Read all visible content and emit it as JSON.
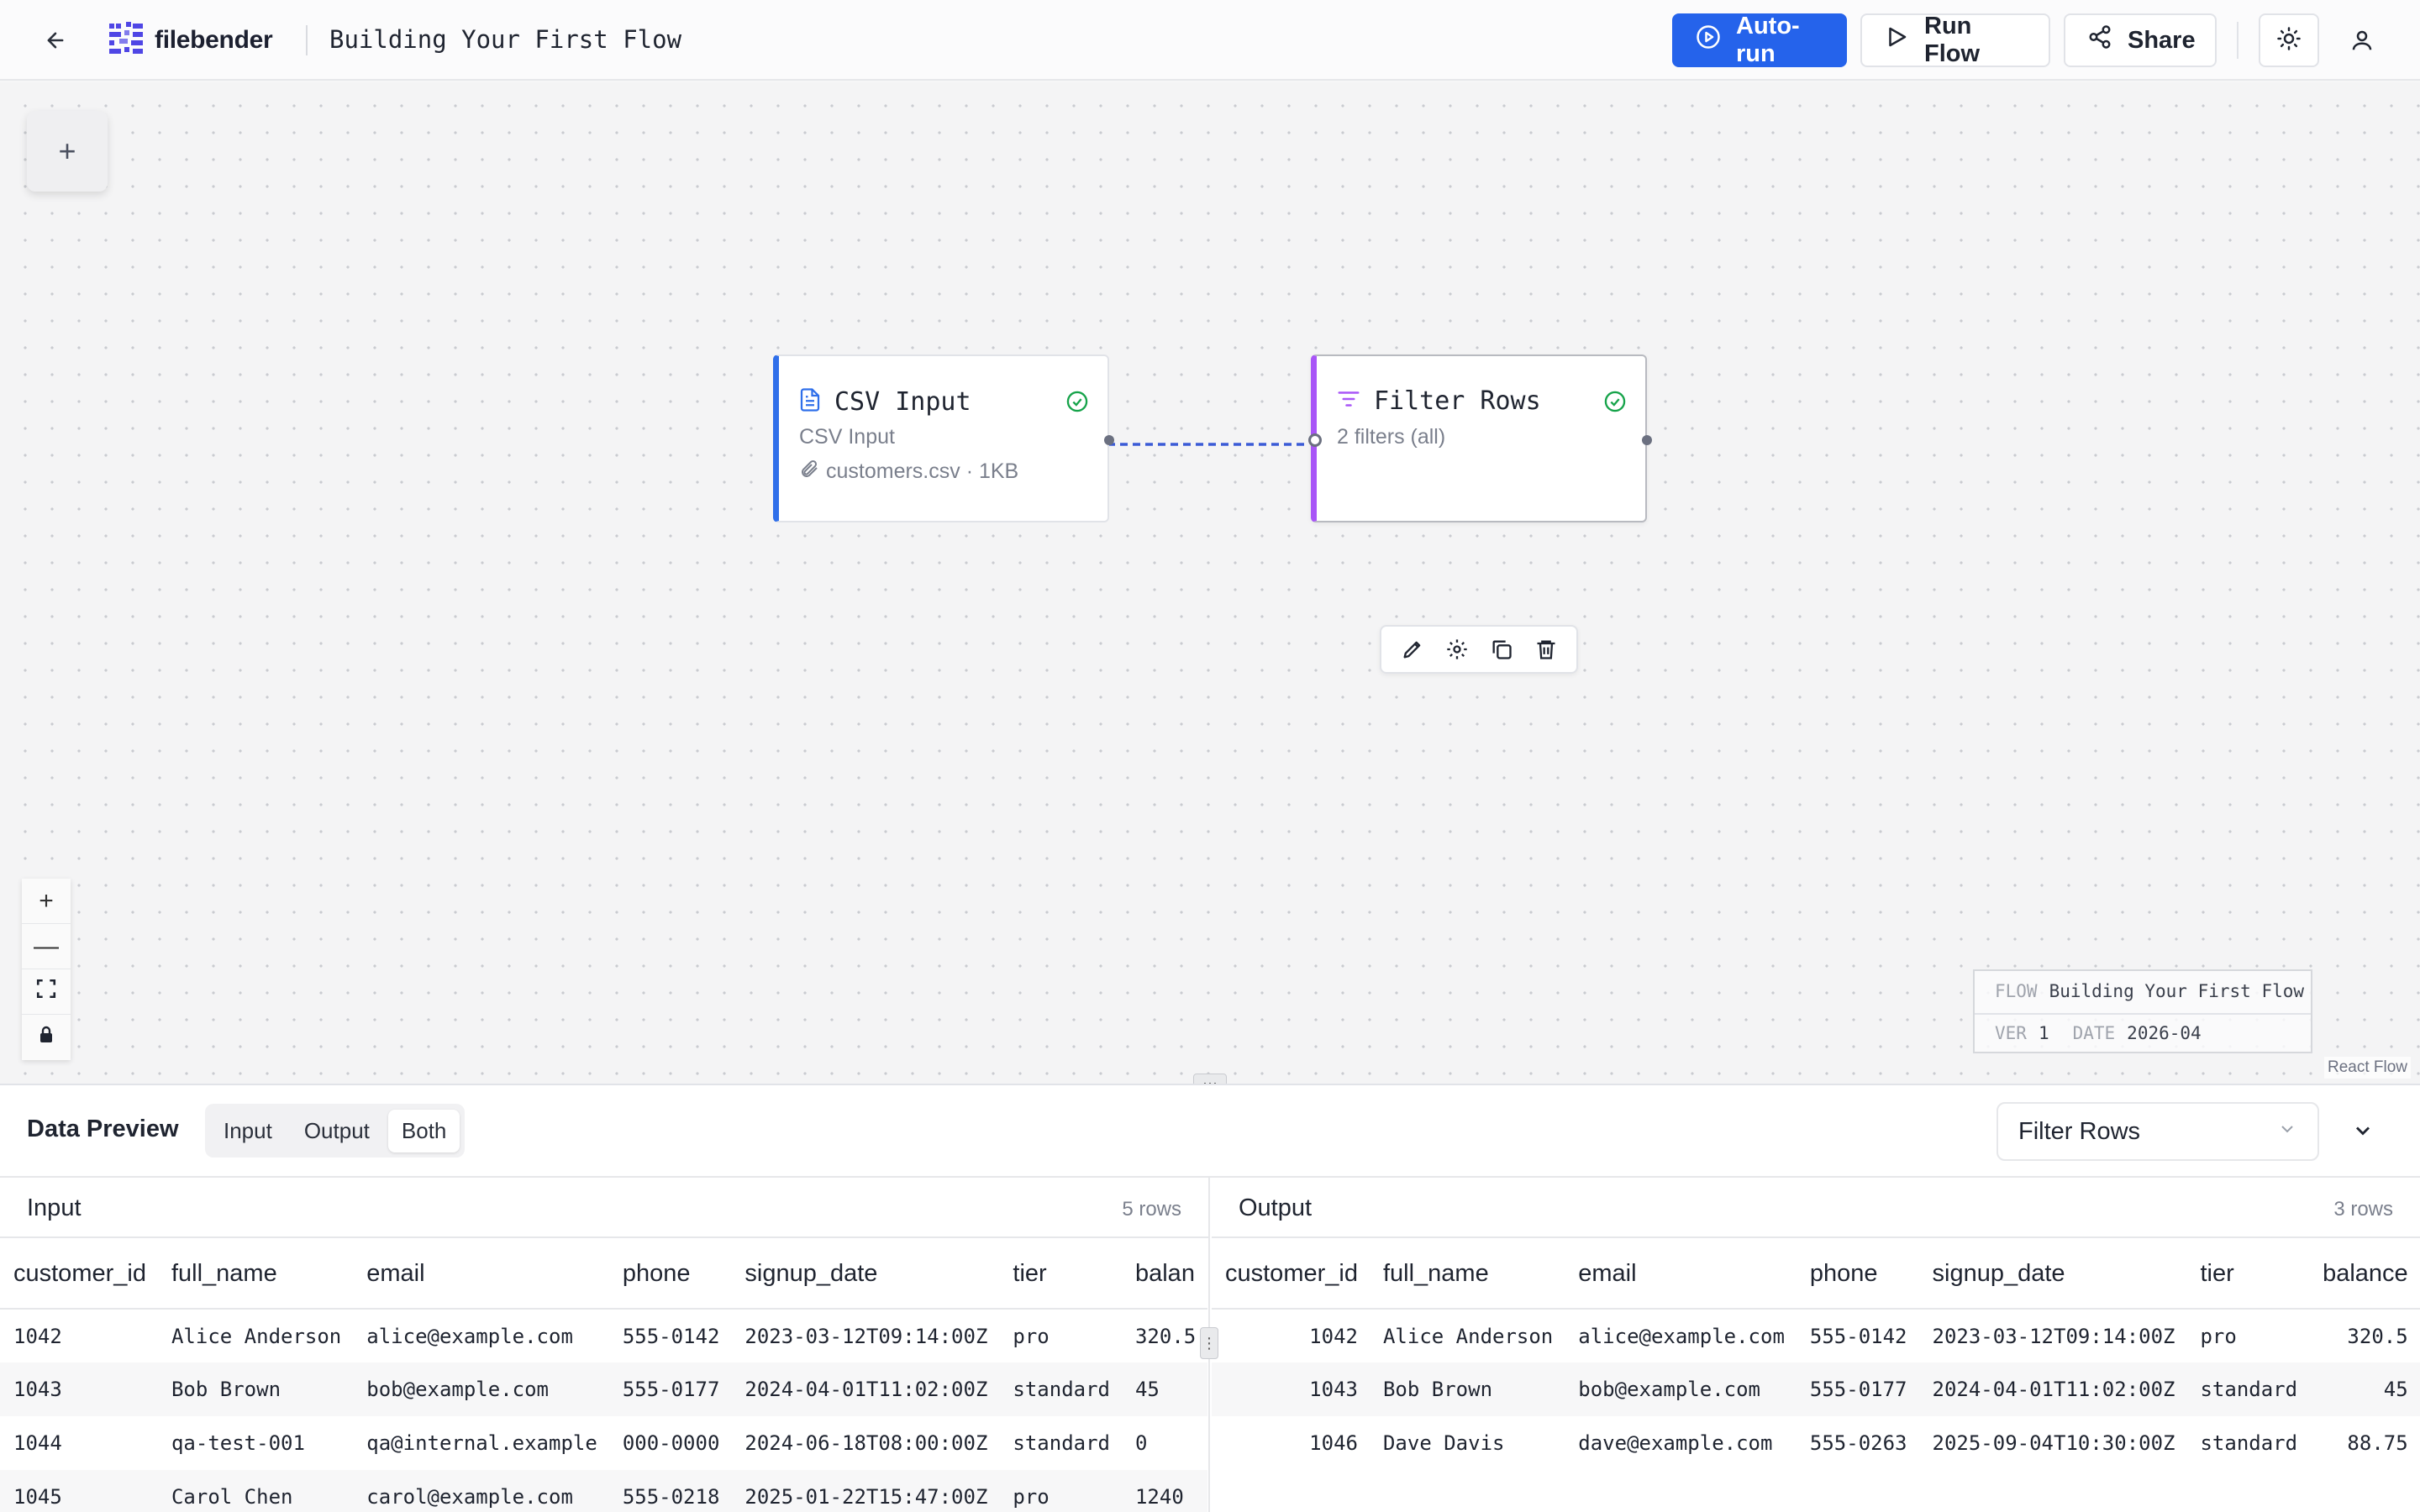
{
  "header": {
    "brand": "filebender",
    "flow_title": "Building Your First Flow",
    "autorun_label": "Auto-run",
    "runflow_label": "Run Flow",
    "share_label": "Share",
    "accent_color": "#2563eb"
  },
  "canvas": {
    "nodes": [
      {
        "title": "CSV Input",
        "subtitle": "CSV Input",
        "file": "customers.csv · 1KB",
        "status": "ok",
        "accent": "#2f6fea"
      },
      {
        "title": "Filter Rows",
        "subtitle": "2 filters (all)",
        "status": "ok",
        "accent": "#a855f7"
      }
    ],
    "info": {
      "flow_key": "FLOW",
      "flow_value": "Building Your First Flow",
      "ver_key": "VER",
      "ver_value": "1",
      "date_key": "DATE",
      "date_value": "2026-04"
    },
    "attribution": "React Flow",
    "zoom_controls": [
      "zoom-in",
      "zoom-out",
      "fit-view",
      "lock"
    ]
  },
  "preview": {
    "title": "Data Preview",
    "tabs": [
      "Input",
      "Output",
      "Both"
    ],
    "active_tab": "Both",
    "selected_node": "Filter Rows",
    "input": {
      "title": "Input",
      "count": "5 rows",
      "columns": [
        "customer_id",
        "full_name",
        "email",
        "phone",
        "signup_date",
        "tier",
        "balan"
      ],
      "rows": [
        [
          "1042",
          "Alice Anderson",
          "alice@example.com",
          "555-0142",
          "2023-03-12T09:14:00Z",
          "pro",
          "320.5"
        ],
        [
          "1043",
          "Bob Brown",
          "bob@example.com",
          "555-0177",
          "2024-04-01T11:02:00Z",
          "standard",
          "45"
        ],
        [
          "1044",
          "qa-test-001",
          "qa@internal.example",
          "000-0000",
          "2024-06-18T08:00:00Z",
          "standard",
          "0"
        ],
        [
          "1045",
          "Carol Chen",
          "carol@example.com",
          "555-0218",
          "2025-01-22T15:47:00Z",
          "pro",
          "1240"
        ]
      ]
    },
    "output": {
      "title": "Output",
      "count": "3 rows",
      "columns": [
        "customer_id",
        "full_name",
        "email",
        "phone",
        "signup_date",
        "tier",
        "balance"
      ],
      "rows": [
        [
          "1042",
          "Alice Anderson",
          "alice@example.com",
          "555-0142",
          "2023-03-12T09:14:00Z",
          "pro",
          "320.5"
        ],
        [
          "1043",
          "Bob Brown",
          "bob@example.com",
          "555-0177",
          "2024-04-01T11:02:00Z",
          "standard",
          "45"
        ],
        [
          "1046",
          "Dave Davis",
          "dave@example.com",
          "555-0263",
          "2025-09-04T10:30:00Z",
          "standard",
          "88.75"
        ]
      ]
    }
  }
}
